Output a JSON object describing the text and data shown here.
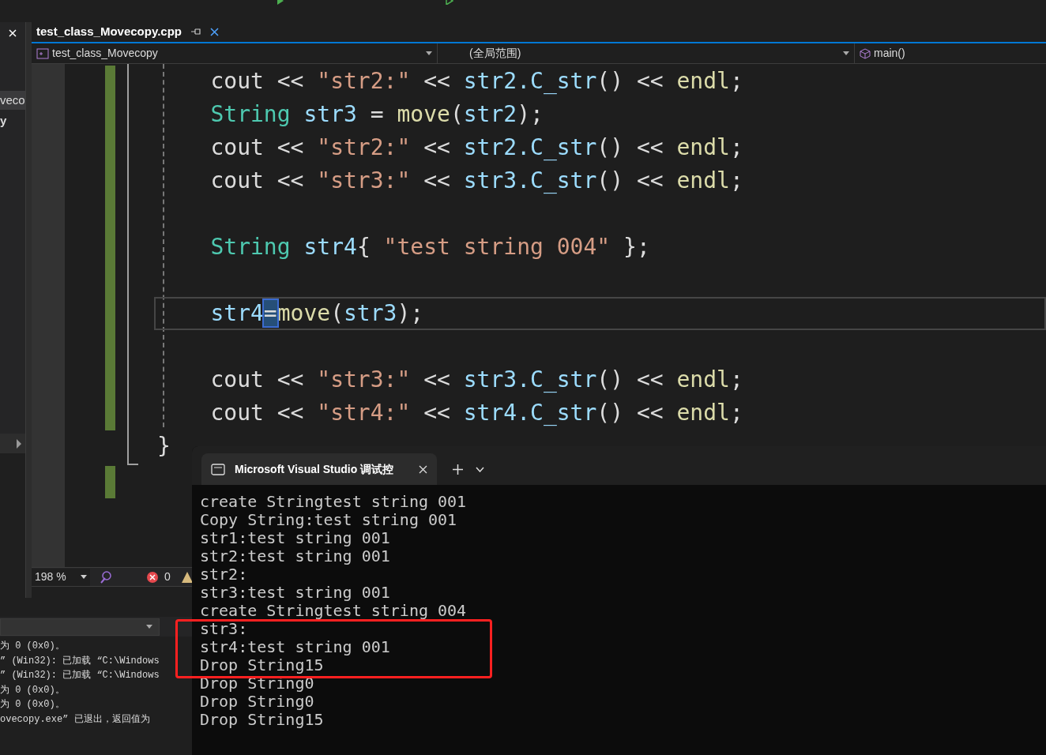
{
  "side_panel": {
    "lines": [
      "veco",
      "y"
    ]
  },
  "editor_tab": {
    "title": "test_class_Movecopy.cpp",
    "selected": true
  },
  "nav_bar": {
    "project": "test_class_Movecopy",
    "scope": "(全局范围)",
    "member": "main()"
  },
  "code": [
    {
      "kind": "code",
      "tokens": [
        {
          "t": "    cout << ",
          "kind": "plain"
        },
        {
          "t": "\"str2:\"",
          "kind": "string"
        },
        {
          "t": " << ",
          "kind": "plain"
        },
        {
          "t": "str2.C_str",
          "kind": "var"
        },
        {
          "t": "() << ",
          "kind": "plain"
        },
        {
          "t": "endl",
          "kind": "func"
        },
        {
          "t": ";",
          "kind": "plain"
        }
      ]
    },
    {
      "kind": "code",
      "tokens": [
        {
          "t": "    String ",
          "kind": "type"
        },
        {
          "t": "str3",
          "kind": "var"
        },
        {
          "t": " = ",
          "kind": "plain"
        },
        {
          "t": "move",
          "kind": "func"
        },
        {
          "t": "(",
          "kind": "plain"
        },
        {
          "t": "str2",
          "kind": "var"
        },
        {
          "t": ");",
          "kind": "plain"
        }
      ]
    },
    {
      "kind": "code",
      "tokens": [
        {
          "t": "    cout << ",
          "kind": "plain"
        },
        {
          "t": "\"str2:\"",
          "kind": "string"
        },
        {
          "t": " << ",
          "kind": "plain"
        },
        {
          "t": "str2.C_str",
          "kind": "var"
        },
        {
          "t": "() << ",
          "kind": "plain"
        },
        {
          "t": "endl",
          "kind": "func"
        },
        {
          "t": ";",
          "kind": "plain"
        }
      ]
    },
    {
      "kind": "code",
      "tokens": [
        {
          "t": "    cout << ",
          "kind": "plain"
        },
        {
          "t": "\"str3:\"",
          "kind": "string"
        },
        {
          "t": " << ",
          "kind": "plain"
        },
        {
          "t": "str3.C_str",
          "kind": "var"
        },
        {
          "t": "() << ",
          "kind": "plain"
        },
        {
          "t": "endl",
          "kind": "func"
        },
        {
          "t": ";",
          "kind": "plain"
        }
      ]
    },
    {
      "kind": "blank"
    },
    {
      "kind": "code",
      "tokens": [
        {
          "t": "    String ",
          "kind": "type"
        },
        {
          "t": "str4",
          "kind": "var"
        },
        {
          "t": "{ ",
          "kind": "plain"
        },
        {
          "t": "\"test string 004\"",
          "kind": "string"
        },
        {
          "t": " };",
          "kind": "plain"
        }
      ]
    },
    {
      "kind": "blank"
    },
    {
      "kind": "current",
      "tokens": [
        {
          "t": "    str4",
          "kind": "var"
        },
        {
          "t": "=",
          "kind": "cursor"
        },
        {
          "t": "move",
          "kind": "func"
        },
        {
          "t": "(",
          "kind": "plain"
        },
        {
          "t": "str3",
          "kind": "var"
        },
        {
          "t": ");",
          "kind": "plain"
        }
      ]
    },
    {
      "kind": "blank"
    },
    {
      "kind": "code",
      "tokens": [
        {
          "t": "    cout << ",
          "kind": "plain"
        },
        {
          "t": "\"str3:\"",
          "kind": "string"
        },
        {
          "t": " << ",
          "kind": "plain"
        },
        {
          "t": "str3.C_str",
          "kind": "var"
        },
        {
          "t": "() << ",
          "kind": "plain"
        },
        {
          "t": "endl",
          "kind": "func"
        },
        {
          "t": ";",
          "kind": "plain"
        }
      ]
    },
    {
      "kind": "code",
      "tokens": [
        {
          "t": "    cout << ",
          "kind": "plain"
        },
        {
          "t": "\"str4:\"",
          "kind": "string"
        },
        {
          "t": " << ",
          "kind": "plain"
        },
        {
          "t": "str4.C_str",
          "kind": "var"
        },
        {
          "t": "() << ",
          "kind": "plain"
        },
        {
          "t": "endl",
          "kind": "func"
        },
        {
          "t": ";",
          "kind": "plain"
        }
      ]
    },
    {
      "kind": "code",
      "tokens": [
        {
          "t": "}",
          "kind": "plain"
        }
      ]
    }
  ],
  "status_bar": {
    "zoom": "198 %",
    "errors": "0"
  },
  "output": {
    "lines": [
      "为 0 (0x0)。",
      "” (Win32): 已加载 “C:\\Windows",
      "” (Win32): 已加载 “C:\\Windows",
      "为 0 (0x0)。",
      "为 0 (0x0)。",
      "ovecopy.exe” 已退出，返回值为"
    ]
  },
  "console": {
    "tab_title": "Microsoft Visual Studio 调试控",
    "lines": [
      "create Stringtest string 001",
      "Copy String:test string 001",
      "str1:test string 001",
      "str2:test string 001",
      "str2:",
      "str3:test string 001",
      "create Stringtest string 004",
      "str3:",
      "str4:test string 001",
      "Drop String15",
      "Drop String0",
      "Drop String0",
      "Drop String15"
    ]
  }
}
